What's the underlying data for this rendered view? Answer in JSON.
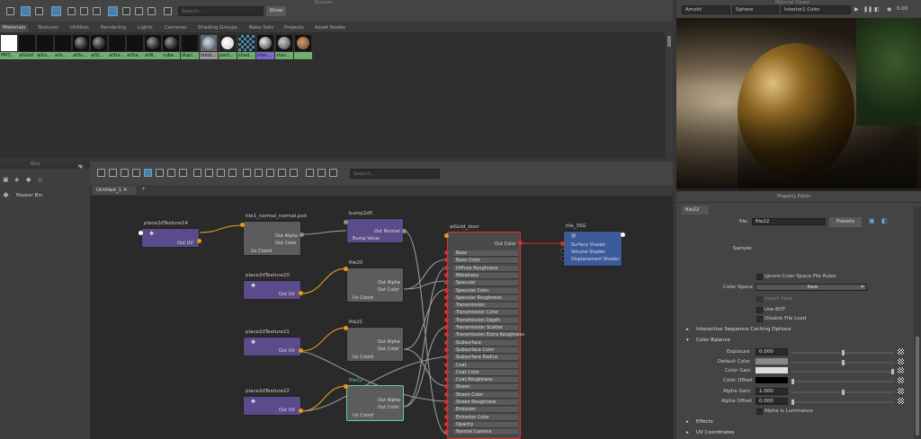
{
  "hypershade_toolbar": {
    "search_placeholder": "Search...",
    "show_label": "Show",
    "top_label": "Browser"
  },
  "tabs": [
    "Materials",
    "Textures",
    "Utilities",
    "Rendering",
    "Lights",
    "Cameras",
    "Shading Groups",
    "Bake Sets",
    "Projects",
    "Asset Nodes"
  ],
  "swatches": [
    "PM3...",
    "aiGold",
    "aiGo...",
    "aiIn...",
    "aiOu...",
    "aiSt...",
    "aiSta...",
    "aiSta...",
    "aiW...",
    "cube...",
    "displ...",
    "lamb...",
    "parti...",
    "shad...",
    "stan...",
    "stan..."
  ],
  "render_view": {
    "panel_label": "Material Viewer",
    "renderer": "Arnold",
    "shape": "Sphere",
    "environment": "Interior1 Color",
    "exposure": "0.00"
  },
  "bins": {
    "title": "Bins",
    "master_bin": "Master Bin"
  },
  "node_editor": {
    "search_placeholder": "Search...",
    "tab": "Untitled_1",
    "add_tab": "+"
  },
  "nodes": {
    "place14": {
      "title": "place2dTexture14",
      "out": "Out UV"
    },
    "tile1": {
      "title": "tile1_normal_normal.psd",
      "alpha": "Out Alpha",
      "color": "Out Color",
      "uv": "Uv Coord"
    },
    "bump": {
      "title": "bump2d5",
      "out": "Out Normal",
      "bump": "Bump Value"
    },
    "place20": {
      "title": "place2dTexture20",
      "out": "Out UV"
    },
    "file20": {
      "title": "file20",
      "alpha": "Out Alpha",
      "color": "Out Color",
      "uv": "Uv Coord"
    },
    "place21": {
      "title": "place2dTexture21",
      "out": "Out UV"
    },
    "file21": {
      "title": "file21",
      "alpha": "Out Alpha",
      "color": "Out Color",
      "uv": "Uv Coord"
    },
    "place22": {
      "title": "place2dTexture22",
      "out": "Out UV"
    },
    "file22": {
      "title": "file22",
      "alpha": "Out Alpha",
      "color": "Out Color",
      "uv": "Uv Coord"
    },
    "shader": {
      "title": "aiGold_door",
      "out": "Out Color",
      "rows": [
        "Base",
        "Base Color",
        "Diffuse Roughness",
        "Metalness",
        "Specular",
        "Specular Color",
        "Specular Roughness",
        "Transmission",
        "Transmission Color",
        "Transmission Depth",
        "Transmission Scatter",
        "Transmission Extra Roughness",
        "Subsurface",
        "Subsurface Color",
        "Subsurface Radius",
        "Coat",
        "Coat Color",
        "Coat Roughness",
        "Sheen",
        "Sheen Color",
        "Sheen Roughness",
        "Emission",
        "Emission Color",
        "Opacity",
        "Normal Camera"
      ]
    },
    "sg": {
      "title": "tile_3SG",
      "rows": [
        "Surface Shader",
        "Volume Shader",
        "Displacement Shader"
      ]
    }
  },
  "property_editor": {
    "title": "Property Editor",
    "tab": "file22",
    "file_label": "file:",
    "file_value": "file22",
    "presets": "Presets",
    "sample": "Sample",
    "ignore_cs": "Ignore Color Space File Rules",
    "color_space_label": "Color Space",
    "color_space_value": "Raw",
    "invert_view": "Invert View",
    "use_bot": "Use BOT",
    "disable_load": "Disable File Load",
    "sec_interactive": "Interactive Sequence Caching Options",
    "sec_color_balance": "Color Balance",
    "exposure_label": "Exposure",
    "exposure": "0.000",
    "default_color": "Default Color",
    "color_gain": "Color Gain",
    "color_offset": "Color Offset",
    "alpha_gain_label": "Alpha Gain",
    "alpha_gain": "1.000",
    "alpha_offset_label": "Alpha Offset",
    "alpha_offset": "0.000",
    "alpha_lum": "Alpha Is Luminance",
    "sec_effects": "Effects",
    "sec_uv": "UV Coordinates"
  }
}
